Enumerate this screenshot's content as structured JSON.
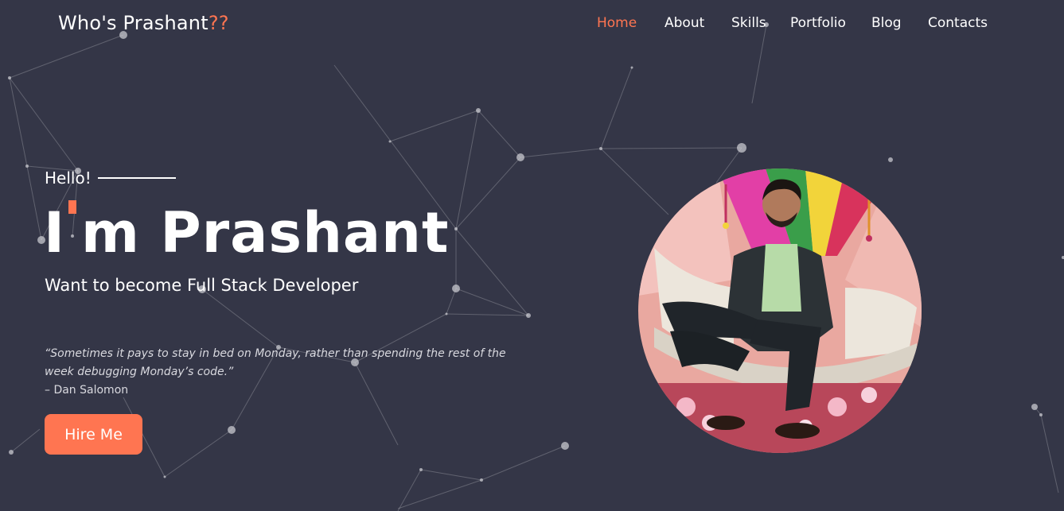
{
  "header": {
    "brand_name": "Who's Prashant",
    "brand_suffix": "??",
    "nav": {
      "home": "Home",
      "about": "About",
      "skills": "Skills",
      "portfolio": "Portfolio",
      "blog": "Blog",
      "contacts": "Contacts"
    },
    "active_item": "Home"
  },
  "hero": {
    "greeting": "Hello!",
    "title_prefix": "I",
    "title_suffix": "m Prashant",
    "subtitle": "Want to become Full Stack Developer",
    "quote": "“Sometimes it pays to stay in bed on Monday, rather than spending the rest of the week debugging Monday’s code.”",
    "quote_author": "– Dan Salomon",
    "cta_label": "Hire Me"
  },
  "colors": {
    "background": "#343647",
    "accent": "#ff7551",
    "text": "#ffffff"
  }
}
